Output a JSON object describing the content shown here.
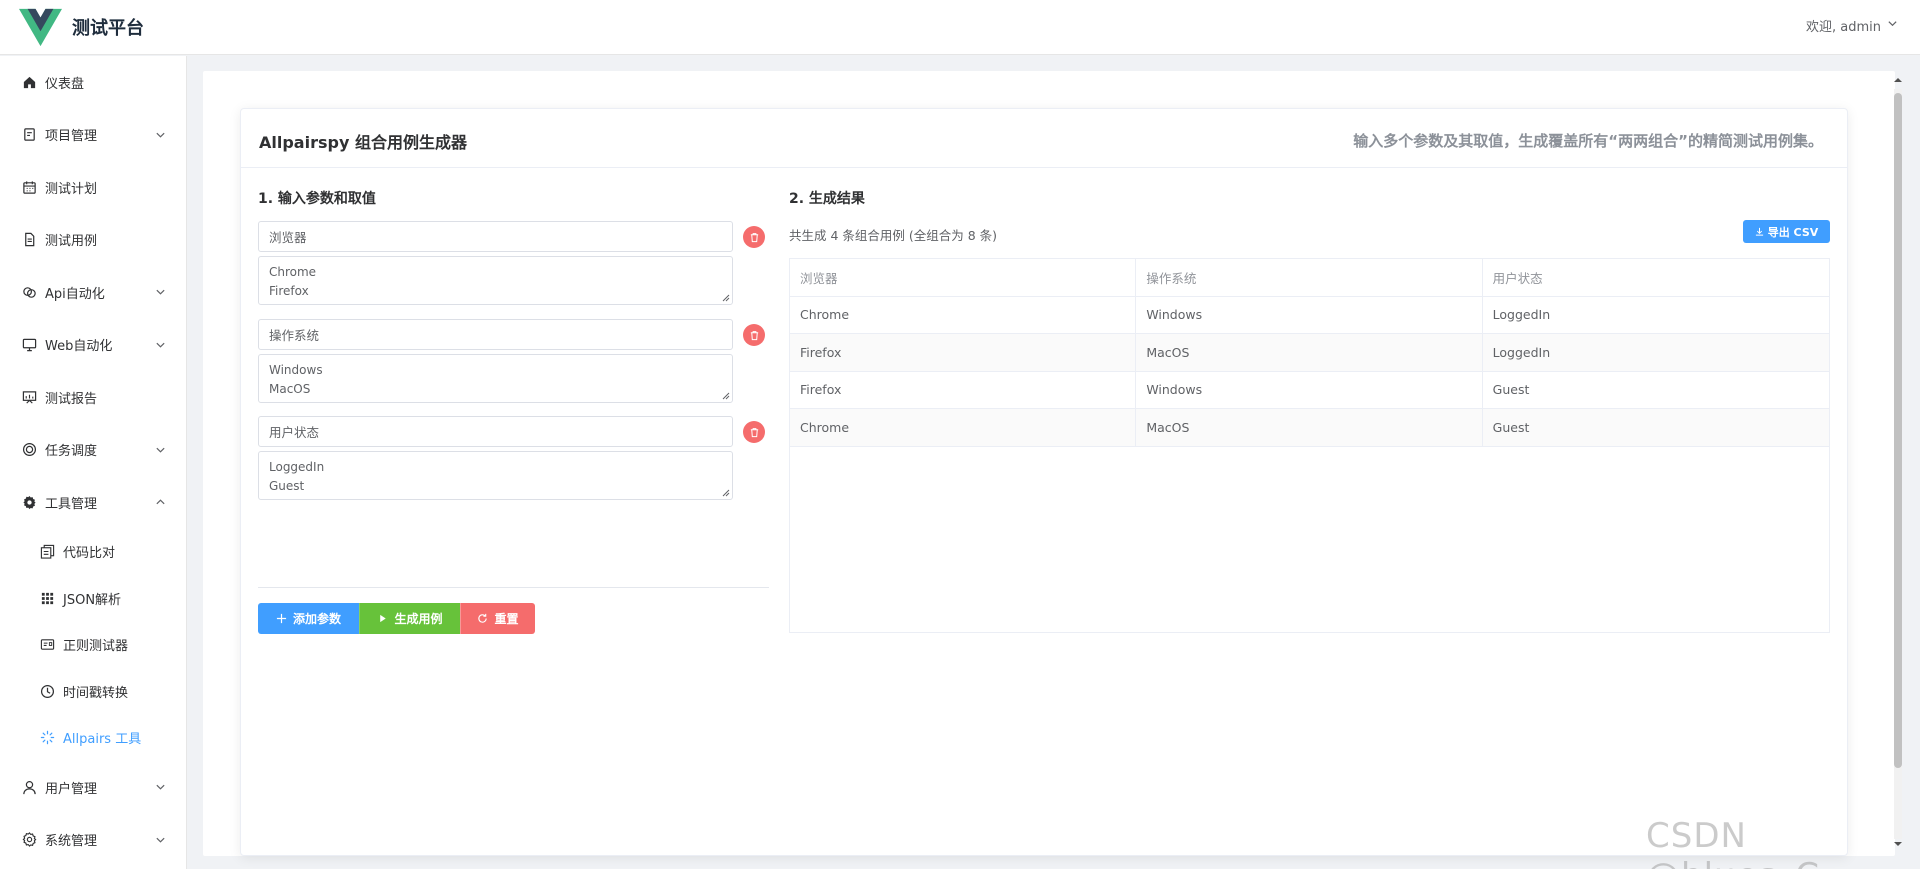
{
  "header": {
    "app_title": "测试平台",
    "user_greeting": "欢迎, admin",
    "logo_colors": {
      "outer": "#41b883",
      "inner": "#35495e"
    }
  },
  "sidebar": {
    "items": [
      {
        "label": "仪表盘",
        "icon": "home-icon",
        "expandable": false
      },
      {
        "label": "项目管理",
        "icon": "clipboard-icon",
        "expandable": true
      },
      {
        "label": "测试计划",
        "icon": "calendar-icon",
        "expandable": false
      },
      {
        "label": "测试用例",
        "icon": "document-icon",
        "expandable": false
      },
      {
        "label": "Api自动化",
        "icon": "link-icon",
        "expandable": true
      },
      {
        "label": "Web自动化",
        "icon": "monitor-icon",
        "expandable": true
      },
      {
        "label": "测试报告",
        "icon": "report-icon",
        "expandable": false
      },
      {
        "label": "任务调度",
        "icon": "target-icon",
        "expandable": true
      },
      {
        "label": "工具管理",
        "icon": "gear-icon",
        "expandable": true,
        "expanded": true
      },
      {
        "label": "用户管理",
        "icon": "user-icon",
        "expandable": true
      },
      {
        "label": "系统管理",
        "icon": "settings-icon",
        "expandable": true
      }
    ],
    "tool_subitems": [
      {
        "label": "代码比对",
        "icon": "copy-icon",
        "active": false
      },
      {
        "label": "JSON解析",
        "icon": "grid-icon",
        "active": false
      },
      {
        "label": "正则测试器",
        "icon": "postcard-icon",
        "active": false
      },
      {
        "label": "时间戳转换",
        "icon": "clock-icon",
        "active": false
      },
      {
        "label": "Allpairs 工具",
        "icon": "loading-icon",
        "active": true
      }
    ]
  },
  "card": {
    "title": "Allpairspy 组合用例生成器",
    "description": "输入多个参数及其取值，生成覆盖所有“两两组合”的精简测试用例集。"
  },
  "input_section": {
    "title": "1. 输入参数和取值",
    "params": [
      {
        "name": "浏览器",
        "values_line1": "Chrome",
        "values_line2": "Firefox"
      },
      {
        "name": "操作系统",
        "values_line1": "Windows",
        "values_line2": "MacOS"
      },
      {
        "name": "用户状态",
        "values_line1": "LoggedIn",
        "values_line2": "Guest"
      }
    ],
    "buttons": {
      "add": "添加参数",
      "generate": "生成用例",
      "reset": "重置"
    }
  },
  "result_section": {
    "title": "2. 生成结果",
    "summary": "共生成 4 条组合用例 (全组合为 8 条)",
    "export_label": "导出 CSV",
    "columns": [
      "浏览器",
      "操作系统",
      "用户状态"
    ],
    "rows": [
      [
        "Chrome",
        "Windows",
        "LoggedIn"
      ],
      [
        "Firefox",
        "MacOS",
        "LoggedIn"
      ],
      [
        "Firefox",
        "Windows",
        "Guest"
      ],
      [
        "Chrome",
        "MacOS",
        "Guest"
      ]
    ]
  },
  "watermark": "CSDN @blues_C",
  "colors": {
    "primary": "#409eff",
    "success": "#67c23a",
    "danger": "#f56c6c",
    "text": "#303133",
    "muted": "#606266"
  }
}
